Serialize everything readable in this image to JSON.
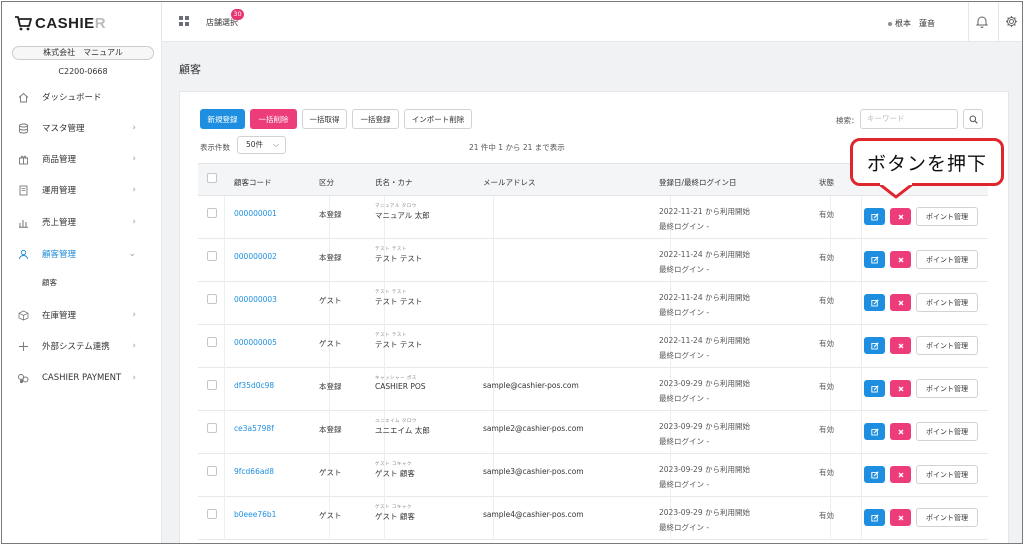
{
  "brand": {
    "logo_main": "CASHIE",
    "logo_tail": "R"
  },
  "sidebar": {
    "company": "株式会社　マニュアル",
    "code": "C2200-0668",
    "items": [
      {
        "label": "ダッシュボード",
        "icon": "home-icon",
        "chevron": false,
        "active": false
      },
      {
        "label": "マスタ管理",
        "icon": "database-icon",
        "chevron": true,
        "active": false
      },
      {
        "label": "商品管理",
        "icon": "gift-icon",
        "chevron": true,
        "active": false
      },
      {
        "label": "運用管理",
        "icon": "document-icon",
        "chevron": true,
        "active": false
      },
      {
        "label": "売上管理",
        "icon": "bar-chart-icon",
        "chevron": true,
        "active": false
      },
      {
        "label": "顧客管理",
        "icon": "user-icon",
        "chevron": true,
        "active": true
      },
      {
        "label": "在庫管理",
        "icon": "box-icon",
        "chevron": true,
        "active": false
      },
      {
        "label": "外部システム連携",
        "icon": "plus-icon",
        "chevron": true,
        "active": false
      },
      {
        "label": "CASHIER PAYMENT",
        "icon": "payment-icon",
        "chevron": true,
        "active": false
      }
    ],
    "sub_item": "顧客"
  },
  "topbar": {
    "store_select": "店舗選択",
    "badge": "30",
    "user_name": "根本　蓮音"
  },
  "page": {
    "title": "顧客"
  },
  "toolbar": {
    "new": "新規登録",
    "bulk_delete": "一括削除",
    "bulk_get": "一括取得",
    "bulk_register": "一括登録",
    "import_delete": "インポート削除",
    "search_label": "検索：",
    "search_placeholder": "キーワード",
    "per_page_label": "表示件数",
    "per_page_value": "50件",
    "summary": "21 件中 1 から 21 まで表示"
  },
  "table": {
    "headers": [
      "顧客コード",
      "区分",
      "氏名・カナ",
      "メールアドレス",
      "登録日/最終ログイン日",
      "状態"
    ],
    "rows": [
      {
        "code": "000000001",
        "type": "本登録",
        "kana": "マニュアル タロウ",
        "name": "マニュアル 太郎",
        "email": "",
        "registered": "2022-11-21 から利用開始",
        "last_login": "最終ログイン -",
        "status": "有効"
      },
      {
        "code": "000000002",
        "type": "本登録",
        "kana": "テスト テスト",
        "name": "テスト テスト",
        "email": "",
        "registered": "2022-11-24 から利用開始",
        "last_login": "最終ログイン -",
        "status": "有効"
      },
      {
        "code": "000000003",
        "type": "ゲスト",
        "kana": "テスト テスト",
        "name": "テスト テスト",
        "email": "",
        "registered": "2022-11-24 から利用開始",
        "last_login": "最終ログイン -",
        "status": "有効"
      },
      {
        "code": "000000005",
        "type": "ゲスト",
        "kana": "テスト テスト",
        "name": "テスト テスト",
        "email": "",
        "registered": "2022-11-24 から利用開始",
        "last_login": "最終ログイン -",
        "status": "有効"
      },
      {
        "code": "df35d0c98",
        "type": "本登録",
        "kana": "キャッシャー ポス",
        "name": "CASHIER POS",
        "email": "sample@cashier-pos.com",
        "registered": "2023-09-29 から利用開始",
        "last_login": "最終ログイン -",
        "status": "有効"
      },
      {
        "code": "ce3a5798f",
        "type": "本登録",
        "kana": "ユニエイム タロウ",
        "name": "ユニエイム 太郎",
        "email": "sample2@cashier-pos.com",
        "registered": "2023-09-29 から利用開始",
        "last_login": "最終ログイン -",
        "status": "有効"
      },
      {
        "code": "9fcd66ad8",
        "type": "ゲスト",
        "kana": "ゲスト コキャク",
        "name": "ゲスト 顧客",
        "email": "sample3@cashier-pos.com",
        "registered": "2023-09-29 から利用開始",
        "last_login": "最終ログイン -",
        "status": "有効"
      },
      {
        "code": "b0eee76b1",
        "type": "ゲスト",
        "kana": "ゲスト コキャク",
        "name": "ゲスト 顧客",
        "email": "sample4@cashier-pos.com",
        "registered": "2023-09-29 から利用開始",
        "last_login": "最終ログイン -",
        "status": "有効"
      }
    ],
    "point_button": "ポイント管理"
  },
  "callout": {
    "text": "ボタンを押下",
    "color": "#e0262d"
  },
  "colors": {
    "accent_blue": "#1e8fe0",
    "accent_pink": "#ec3c7a"
  }
}
